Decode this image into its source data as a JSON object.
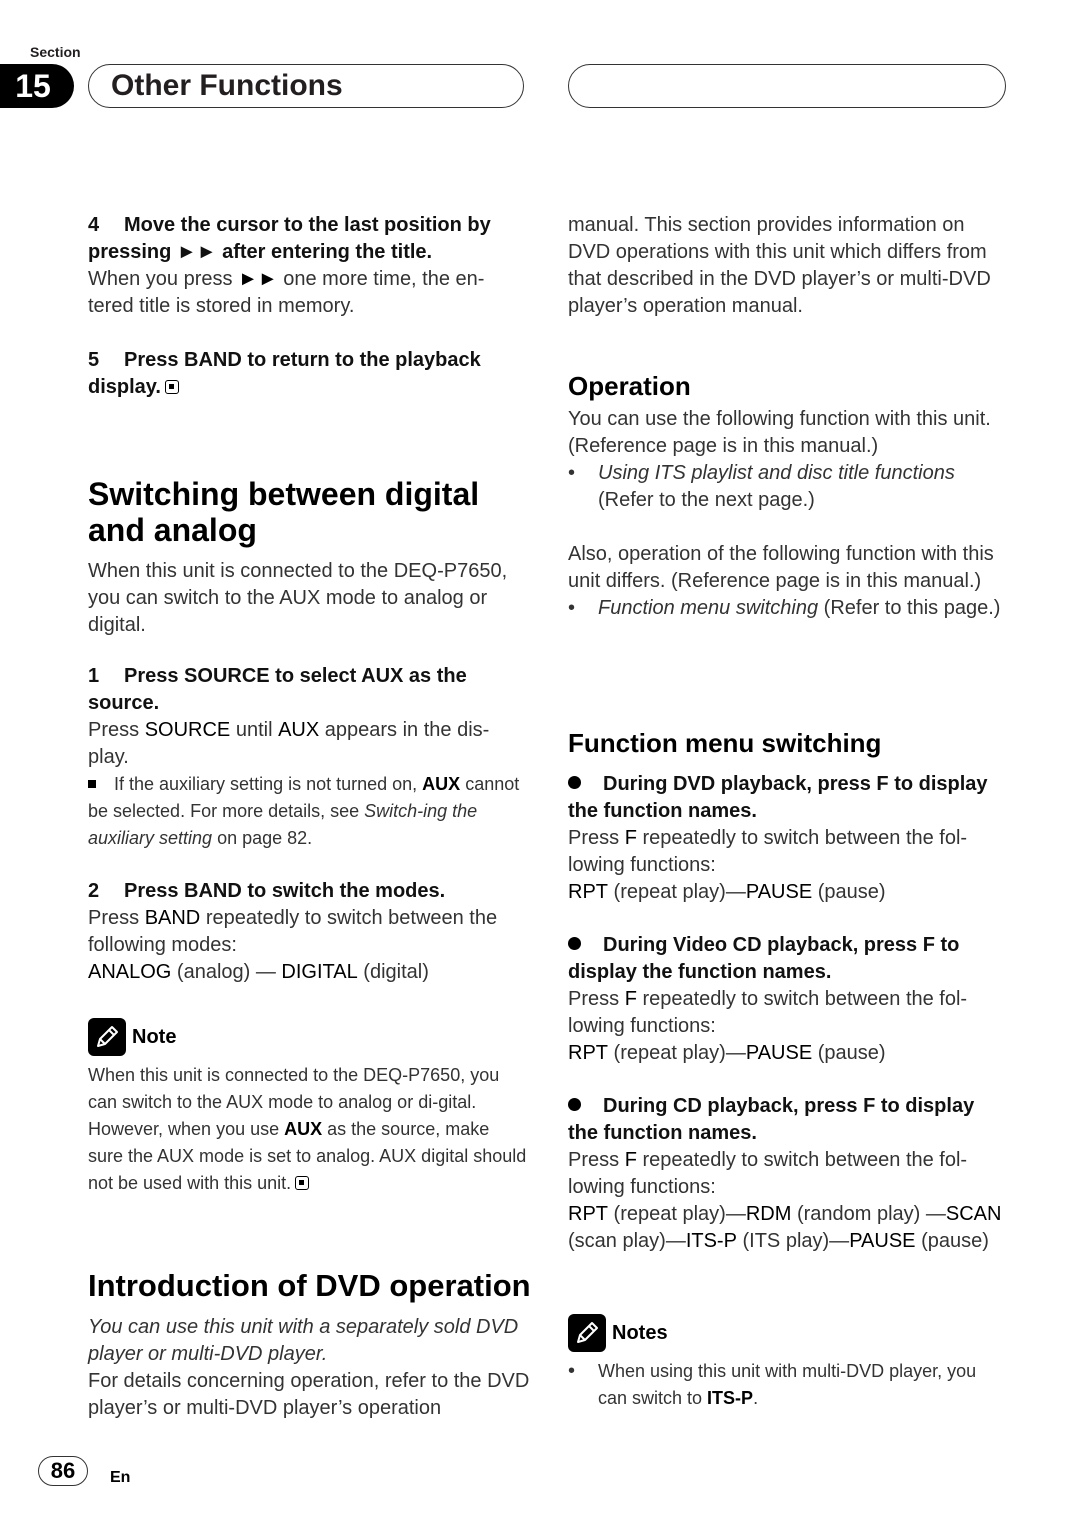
{
  "header": {
    "section_label": "Section",
    "section_number": "15",
    "section_title": "Other Functions"
  },
  "left": {
    "step4": {
      "num": "4",
      "title_a": "Move the cursor to the last position by pressing ",
      "title_sym": "►►",
      "title_b": " after entering the title.",
      "body_a": "When you press ",
      "body_sym": "►►",
      "body_b": " one more time, the en-tered title is stored in memory."
    },
    "step5": {
      "num": "5",
      "title": "Press BAND to return to the playback display."
    },
    "switching": {
      "heading": "Switching between digital and analog",
      "intro": "When this unit is connected to the DEQ-P7650, you can switch to the AUX mode to analog or digital.",
      "step1": {
        "num": "1",
        "title": "Press SOURCE to select AUX as the source.",
        "body_a": "Press ",
        "body_b1": "SOURCE",
        "body_c": " until ",
        "body_b2": "AUX",
        "body_d": " appears in the dis-play.",
        "hint_a": "If the auxiliary setting is not turned on, ",
        "hint_b": "AUX",
        "hint_c": " cannot be selected. For more details, see ",
        "hint_i": "Switch-ing the auxiliary setting",
        "hint_d": " on page 82."
      },
      "step2": {
        "num": "2",
        "title": "Press BAND to switch the modes.",
        "body_a": "Press ",
        "body_b": "BAND",
        "body_c": " repeatedly to switch between the following modes:",
        "mode1": "ANALOG",
        "mode1_desc": " (analog) — ",
        "mode2": "DIGITAL",
        "mode2_desc": " (digital)"
      },
      "note": {
        "label": "Note",
        "text_a": "When this unit is connected to the DEQ-P7650, you can switch to the AUX mode to analog or di-gital. However, when you use ",
        "text_b": "AUX",
        "text_c": " as the source, make sure the AUX mode is set to analog. AUX digital should not be used with this unit."
      }
    },
    "intro_dvd": {
      "heading": "Introduction of DVD operation",
      "italic": "You can use this unit with a separately sold DVD player or multi-DVD player.",
      "body": "For details concerning operation, refer to the DVD player’s or multi-DVD player’s operation"
    }
  },
  "right": {
    "continued": "manual. This section provides information on DVD operations with this unit which differs from that described in the DVD player’s or multi-DVD player’s operation manual.",
    "operation": {
      "heading": "Operation",
      "body1": "You can use the following function with this unit. (Reference page is in this manual.)",
      "bullet1_i": "Using ITS playlist and disc title functions",
      "bullet1_t": " (Refer to the next page.)",
      "body2": "Also, operation of the following function with this unit differs. (Reference page is in this manual.)",
      "bullet2_i": "Function menu switching",
      "bullet2_t": " (Refer to this page.)"
    },
    "function_menu": {
      "heading": "Function menu switching",
      "dvd": {
        "title": "During DVD playback, press F to display the function names.",
        "body_a": "Press ",
        "body_b": "F",
        "body_c": " repeatedly to switch between the fol-lowing functions:",
        "f1": "RPT",
        "f1d": " (repeat play)—",
        "f2": "PAUSE",
        "f2d": " (pause)"
      },
      "vcd": {
        "title": "During Video CD playback, press F to display the function names.",
        "body_a": "Press ",
        "body_b": "F",
        "body_c": " repeatedly to switch between the fol-lowing functions:",
        "f1": "RPT",
        "f1d": " (repeat play)—",
        "f2": "PAUSE",
        "f2d": " (pause)"
      },
      "cd": {
        "title": "During CD playback, press F to display the function names.",
        "body_a": "Press ",
        "body_b": "F",
        "body_c": " repeatedly to switch between the fol-lowing functions:",
        "f1": "RPT",
        "f1d": " (repeat play)—",
        "f2": "RDM",
        "f2d": " (random play) —",
        "f3": "SCAN",
        "f3d": " (scan play)—",
        "f4": "ITS-P",
        "f4d": " (ITS play)—",
        "f5": "PAUSE",
        "f5d": " (pause)"
      }
    },
    "notes": {
      "label": "Notes",
      "bullet_a": "When using this unit with multi-DVD player, you can switch to ",
      "bullet_b": "ITS-P",
      "bullet_c": "."
    }
  },
  "footer": {
    "page_number": "86",
    "language": "En"
  }
}
